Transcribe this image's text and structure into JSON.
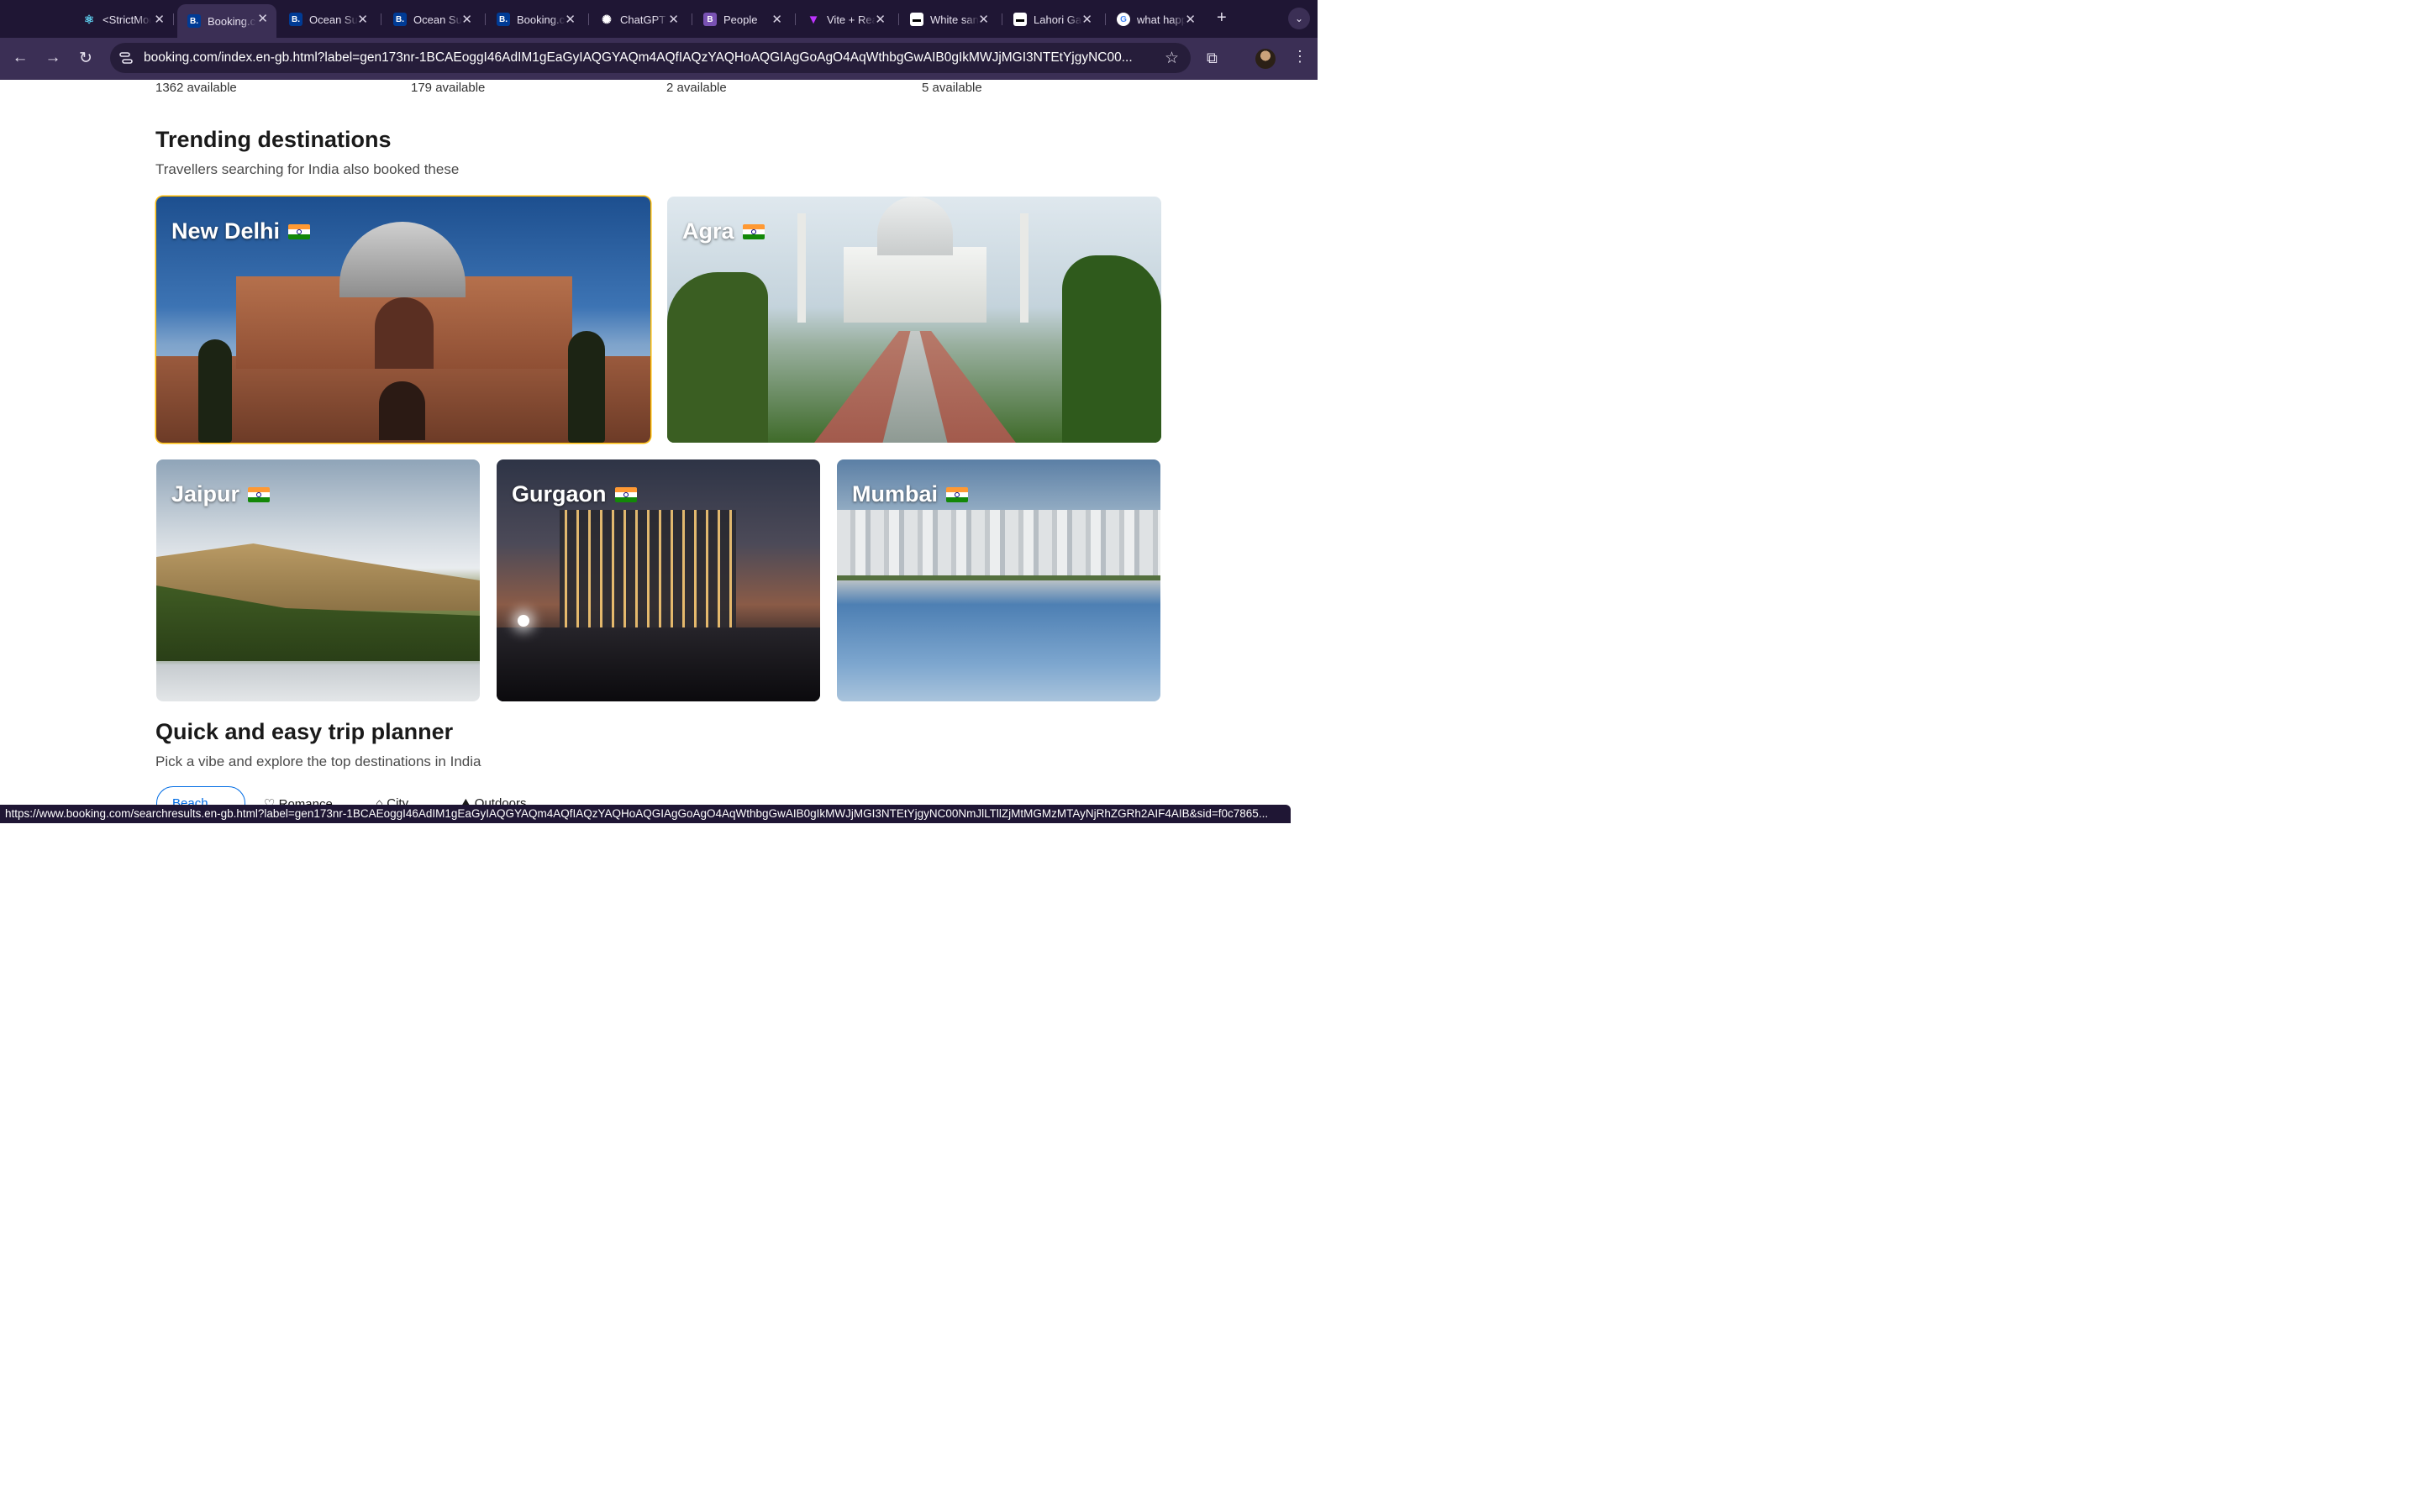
{
  "browser": {
    "tabs": [
      {
        "title": "<StrictMode>",
        "favicon": "react-icon",
        "color": "#5fd3f3"
      },
      {
        "title": "Booking.com",
        "favicon": "booking-icon",
        "color": "#003b95",
        "active": true
      },
      {
        "title": "Ocean Suites",
        "favicon": "booking-icon",
        "color": "#003b95"
      },
      {
        "title": "Ocean Suites",
        "favicon": "booking-icon",
        "color": "#003b95"
      },
      {
        "title": "Booking.com",
        "favicon": "booking-icon",
        "color": "#003b95"
      },
      {
        "title": "ChatGPT",
        "favicon": "chatgpt-icon",
        "color": "#ffffff"
      },
      {
        "title": "People",
        "favicon": "bootstrap-icon",
        "color": "#7952b3"
      },
      {
        "title": "Vite + React",
        "favicon": "vite-icon",
        "color": "#bd34fe"
      },
      {
        "title": "White sands",
        "favicon": "doc-icon",
        "color": "#ffffff"
      },
      {
        "title": "Lahori Gate",
        "favicon": "doc-icon",
        "color": "#ffffff"
      },
      {
        "title": "what happens",
        "favicon": "google-icon",
        "color": "#4285f4"
      }
    ],
    "url": "booking.com/index.en-gb.html?label=gen173nr-1BCAEoggI46AdIM1gEaGyIAQGYAQm4AQfIAQzYAQHoAQGIAgGoAgO4AqWthbgGwAIB0gIkMWJjMGI3NTEtYjgyNC00...",
    "status_url": "https://www.booking.com/searchresults.en-gb.html?label=gen173nr-1BCAEoggI46AdIM1gEaGyIAQGYAQm4AQfIAQzYAQHoAQGIAgGoAgO4AqWthbgGwAIB0gIkMWJjMGI3NTEtYjgyNC00NmJlLTllZjMtMGMzMTAyNjRhZGRh2AIF4AIB&sid=f0c7865..."
  },
  "availability": [
    "1362 available",
    "179 available",
    "2 available",
    "5 available"
  ],
  "trending": {
    "title": "Trending destinations",
    "subtitle": "Travellers searching for India also booked these",
    "destinations": [
      {
        "name": "New Delhi",
        "flag": "india-flag-icon"
      },
      {
        "name": "Agra",
        "flag": "india-flag-icon"
      },
      {
        "name": "Jaipur",
        "flag": "india-flag-icon"
      },
      {
        "name": "Gurgaon",
        "flag": "india-flag-icon"
      },
      {
        "name": "Mumbai",
        "flag": "india-flag-icon"
      }
    ]
  },
  "planner": {
    "title": "Quick and easy trip planner",
    "subtitle": "Pick a vibe and explore the top destinations in India",
    "vibes": [
      "Beach",
      "Romance",
      "City",
      "Outdoors"
    ]
  },
  "colors": {
    "booking_blue": "#006ce4",
    "highlight": "#febb02",
    "browser_frame": "#3b2f55"
  }
}
